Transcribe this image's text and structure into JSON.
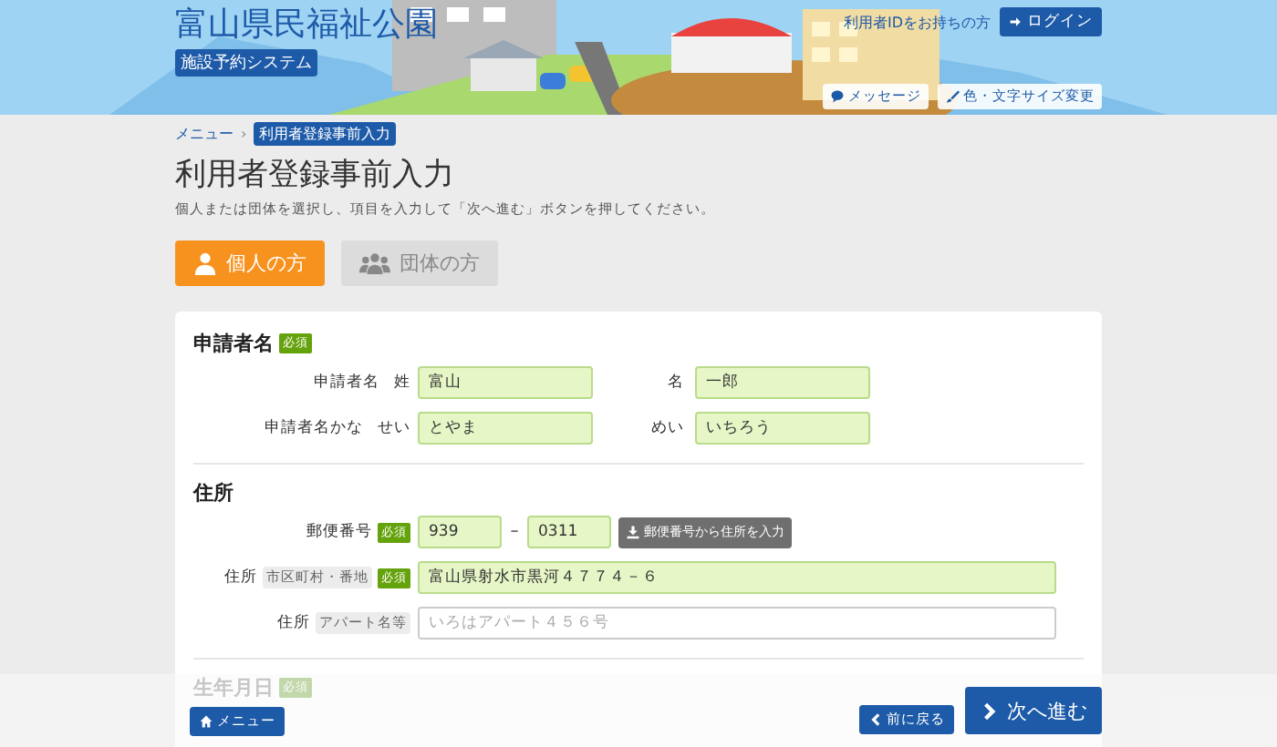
{
  "header": {
    "title": "富山県民福祉公園",
    "subtitle": "施設予約システム",
    "login_prompt": "利用者IDをお持ちの方",
    "login_button": "ログイン",
    "message_button": "メッセージ",
    "display_button": "色・文字サイズ変更"
  },
  "breadcrumb": [
    {
      "label": "メニュー",
      "current": false
    },
    {
      "label": "利用者登録事前入力",
      "current": true
    }
  ],
  "breadcrumb_separator": "›",
  "page_title": "利用者登録事前入力",
  "description": "個人または団体を選択し、項目を入力して「次へ進む」ボタンを押してください。",
  "tabs": [
    {
      "label": "個人の方",
      "selected": true,
      "kind": "person"
    },
    {
      "label": "団体の方",
      "selected": false,
      "kind": "group"
    }
  ],
  "applicant_name": {
    "title": "申請者名",
    "required": "必須",
    "rows": [
      {
        "label": "申請者名",
        "sublabel": "姓",
        "value": "富山",
        "label2": "名",
        "value2": "一郎"
      },
      {
        "label": "申請者名かな",
        "sublabel": "せい",
        "value": "とやま",
        "label2": "めい",
        "value2": "いちろう"
      }
    ]
  },
  "address": {
    "title": "住所",
    "postal": {
      "label": "郵便番号",
      "required": "必須",
      "value1": "939",
      "separator": "–",
      "value2": "0311",
      "button": "郵便番号から住所を入力"
    },
    "rows": [
      {
        "label": "住所",
        "tag": "市区町村・番地",
        "required": "必須",
        "value": "富山県射水市黒河４７７４－６"
      },
      {
        "label": "住所",
        "tag": "アパート名等",
        "placeholder": "いろはアパート４５６号"
      }
    ]
  },
  "birthdate": {
    "title": "生年月日",
    "required": "必須"
  },
  "footer": {
    "menu_button": "メニュー",
    "back_button": "前に戻る",
    "next_button": "次へ進む"
  }
}
